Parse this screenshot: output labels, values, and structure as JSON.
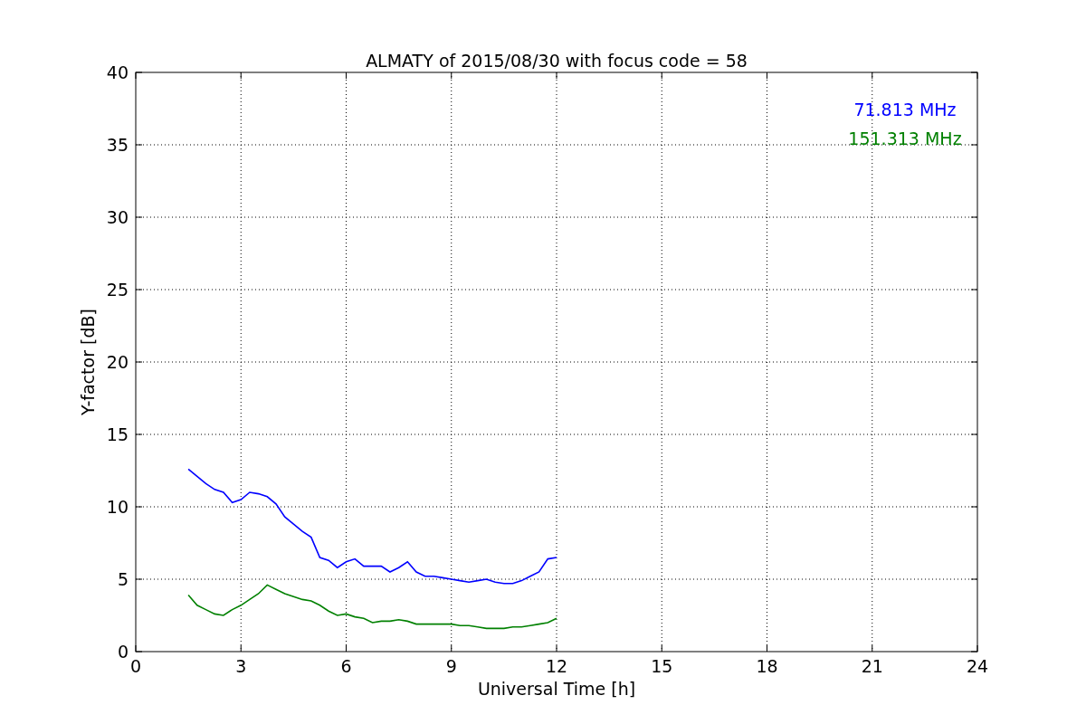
{
  "chart_data": {
    "type": "line",
    "title": "ALMATY of 2015/08/30 with focus code = 58",
    "xlabel": "Universal Time [h]",
    "ylabel": "Y-factor [dB]",
    "x": [
      1.5,
      1.75,
      2,
      2.25,
      2.5,
      2.75,
      3,
      3.25,
      3.5,
      3.75,
      4,
      4.25,
      4.5,
      4.75,
      5,
      5.25,
      5.5,
      5.75,
      6,
      6.25,
      6.5,
      6.75,
      7,
      7.25,
      7.5,
      7.75,
      8,
      8.25,
      8.5,
      8.75,
      9,
      9.25,
      9.5,
      9.75,
      10,
      10.25,
      10.5,
      10.75,
      11,
      11.25,
      11.5,
      11.75,
      12
    ],
    "series": [
      {
        "name": "71.813 MHz",
        "color": "#0000ff",
        "values": [
          12.6,
          12.1,
          11.6,
          11.2,
          11.0,
          10.3,
          10.5,
          11.0,
          10.9,
          10.7,
          10.2,
          9.3,
          8.8,
          8.3,
          7.9,
          6.5,
          6.3,
          5.8,
          6.2,
          6.4,
          5.9,
          5.9,
          5.9,
          5.5,
          5.8,
          6.2,
          5.5,
          5.2,
          5.2,
          5.1,
          5.0,
          4.9,
          4.8,
          4.9,
          5.0,
          4.8,
          4.7,
          4.7,
          4.9,
          5.2,
          5.5,
          6.4,
          6.5
        ]
      },
      {
        "name": "151.313 MHz",
        "color": "#008000",
        "values": [
          3.9,
          3.2,
          2.9,
          2.6,
          2.5,
          2.9,
          3.2,
          3.6,
          4.0,
          4.6,
          4.3,
          4.0,
          3.8,
          3.6,
          3.5,
          3.2,
          2.8,
          2.5,
          2.6,
          2.4,
          2.3,
          2.0,
          2.1,
          2.1,
          2.2,
          2.1,
          1.9,
          1.9,
          1.9,
          1.9,
          1.9,
          1.8,
          1.8,
          1.7,
          1.6,
          1.6,
          1.6,
          1.7,
          1.7,
          1.8,
          1.9,
          2.0,
          2.3
        ]
      }
    ],
    "xlim": [
      0,
      24
    ],
    "ylim": [
      0,
      40
    ],
    "xticks": [
      0,
      3,
      6,
      9,
      12,
      15,
      18,
      21,
      24
    ],
    "yticks": [
      0,
      5,
      10,
      15,
      20,
      25,
      30,
      35,
      40
    ],
    "grid": true
  }
}
